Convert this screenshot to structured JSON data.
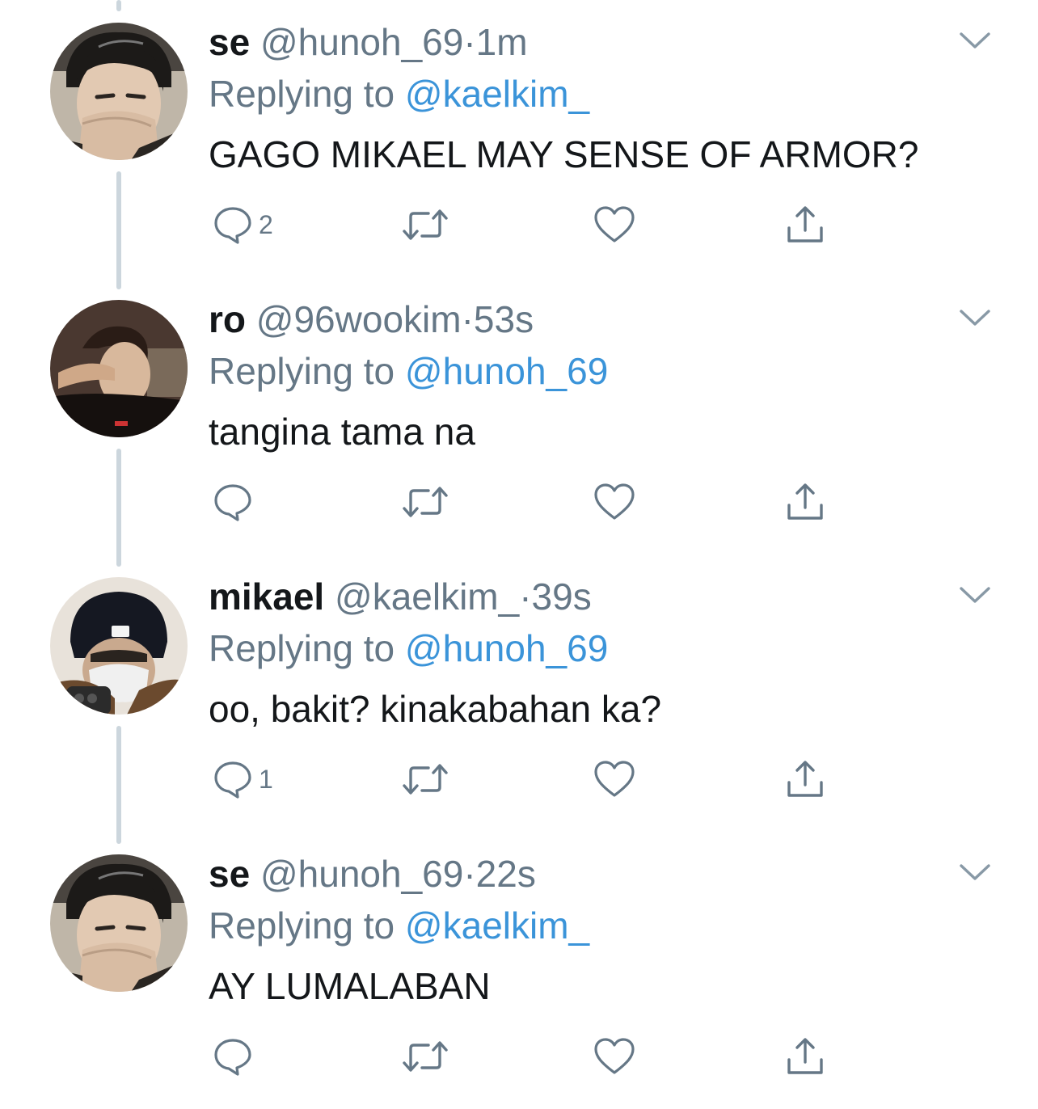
{
  "colors": {
    "text": "#14171a",
    "secondary": "#657786",
    "mention": "#3b94d9",
    "icon": "#657786",
    "thread_line": "#ccd6dd"
  },
  "tweets": [
    {
      "display_name": "se",
      "handle": "@hunoh_69",
      "separator": "·",
      "time": "1m",
      "replying_prefix": "Replying to",
      "replying_to": "@kaelkim_",
      "text": "GAGO MIKAEL MAY SENSE OF ARMOR?",
      "reply_count": "2",
      "avatar": "avatar-se"
    },
    {
      "display_name": "ro",
      "handle": "@96wookim",
      "separator": "·",
      "time": "53s",
      "replying_prefix": "Replying to",
      "replying_to": "@hunoh_69",
      "text": "tangina tama na",
      "reply_count": "",
      "avatar": "avatar-ro"
    },
    {
      "display_name": "mikael",
      "handle": "@kaelkim_",
      "separator": "·",
      "time": "39s",
      "replying_prefix": "Replying to",
      "replying_to": "@hunoh_69",
      "text": "oo, bakit? kinakabahan ka?",
      "reply_count": "1",
      "avatar": "avatar-mikael"
    },
    {
      "display_name": "se",
      "handle": "@hunoh_69",
      "separator": "·",
      "time": "22s",
      "replying_prefix": "Replying to",
      "replying_to": "@kaelkim_",
      "text": "AY LUMALABAN",
      "reply_count": "",
      "avatar": "avatar-se"
    }
  ],
  "icons": {
    "reply": "reply-icon",
    "retweet": "retweet-icon",
    "like": "heart-icon",
    "share": "share-icon",
    "more": "chevron-down-icon"
  }
}
